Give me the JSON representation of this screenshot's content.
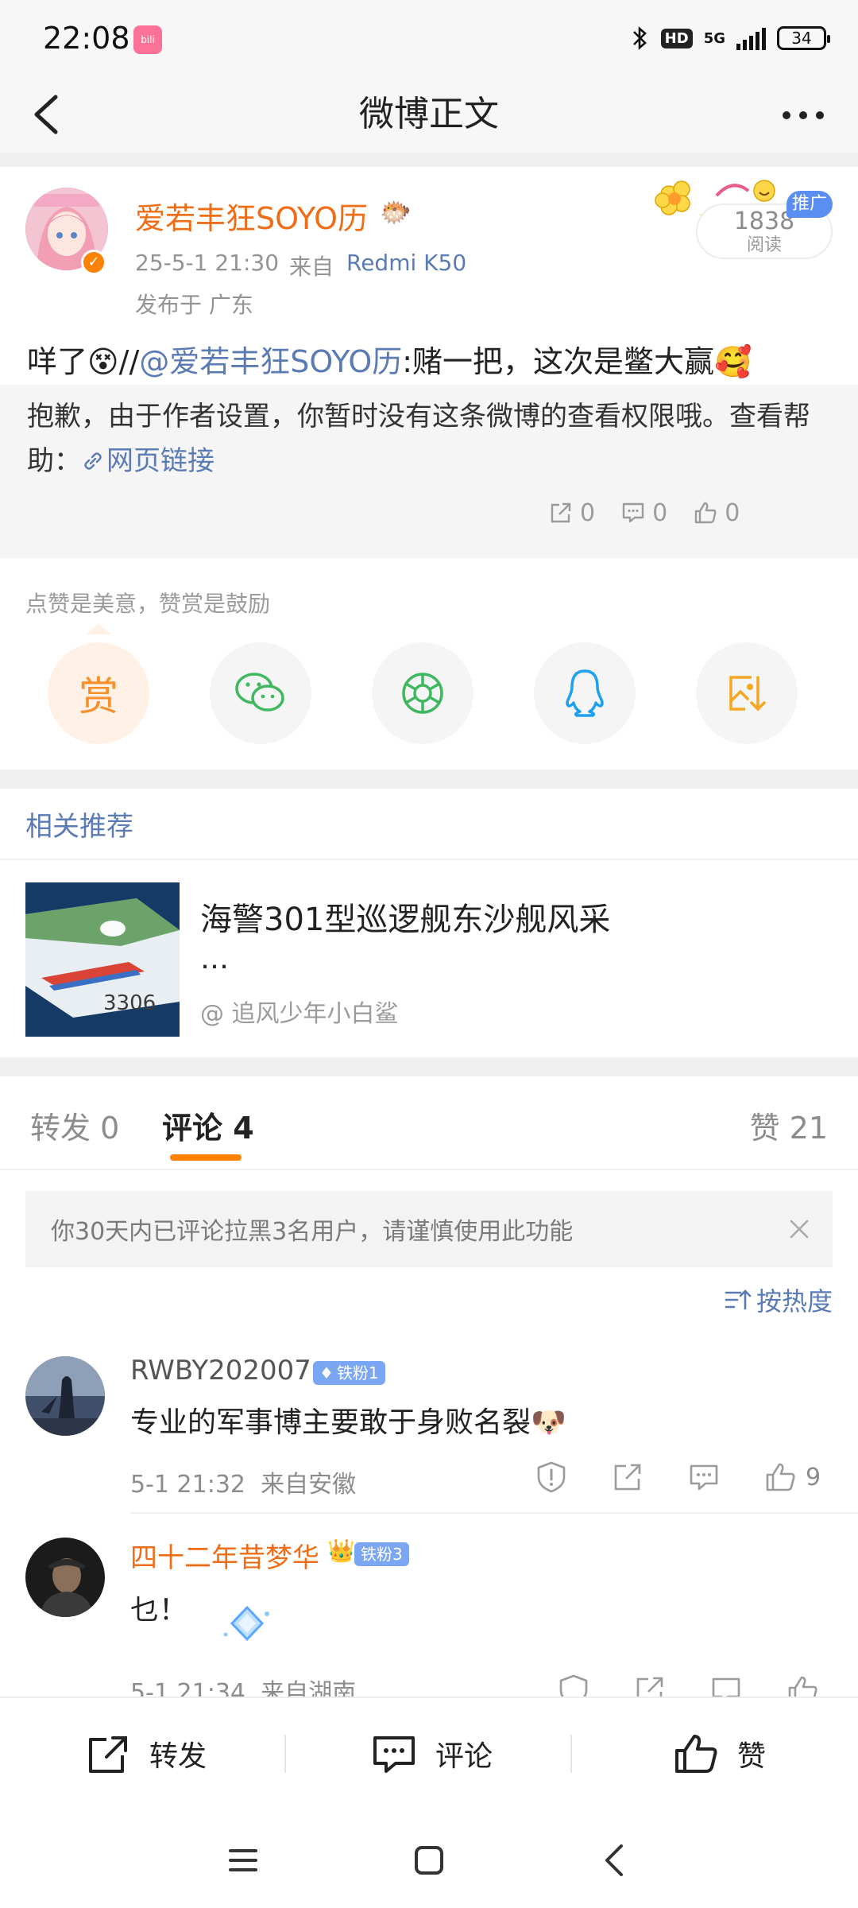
{
  "status_bar": {
    "time": "22:08",
    "app_icon": "bilibili",
    "network": "5G",
    "hd": "HD",
    "battery": "34"
  },
  "nav": {
    "title": "微博正文",
    "back_icon": "back-chevron-icon",
    "more_icon": "more-dots-icon"
  },
  "post": {
    "author": "爱若丰狂SOYO历",
    "author_badge": "🐡",
    "time": "25-5-1 21:30",
    "source_prefix": "来自",
    "source": "Redmi K50",
    "location": "发布于 广东",
    "read_count": "1838",
    "read_label": "阅读",
    "ad_tag": "推广",
    "text_prefix": "咩了",
    "text_emoji": "😵",
    "text_separator": "//",
    "mention": "@爱若丰狂SOYO历",
    "text_suffix": ":赌一把，这次是鳖大赢",
    "text_end_emoji": "🥰"
  },
  "retweet": {
    "text": "抱歉，由于作者设置，你暂时没有这条微博的查看权限哦。查看帮助：",
    "link_label": "网页链接",
    "link_icon": "link-icon",
    "repost_count": "0",
    "comment_count": "0",
    "like_count": "0"
  },
  "reward": {
    "hint": "点赞是美意，赞赏是鼓励",
    "reward_label": "赏",
    "share_targets": [
      "wechat-icon",
      "moments-icon",
      "qq-icon",
      "save-image-icon"
    ]
  },
  "recommend": {
    "title": "相关推荐",
    "headline": "海警301型巡逻舰东沙舰风采",
    "ellipsis": "…",
    "author": "@ 追风少年小白鲨",
    "thumb_text": "3306"
  },
  "tabs": {
    "repost": "转发 0",
    "comment": "评论 4",
    "like": "赞 21"
  },
  "notice": {
    "text": "你30天内已评论拉黑3名用户，请谨慎使用此功能"
  },
  "sort": {
    "label": "按热度"
  },
  "comments": [
    {
      "name": "RWBY202007",
      "badge": "铁粉1",
      "text": "专业的军事博主要敢于身败名裂",
      "emoji": "🐶",
      "time": "5-1 21:32",
      "location": "来自安徽",
      "likes": "9",
      "name_color": "#555555"
    },
    {
      "name": "四十二年昔梦华",
      "badge": "铁粉3",
      "text": "乜！",
      "time": "5-1 21:34",
      "location": "来自湖南",
      "name_color": "#f06d17"
    }
  ],
  "bottom_bar": {
    "repost": "转发",
    "comment": "评论",
    "like": "赞"
  },
  "colors": {
    "accent_orange": "#ff8200",
    "link_blue": "#5b7bb5",
    "author_orange": "#f06d17"
  }
}
